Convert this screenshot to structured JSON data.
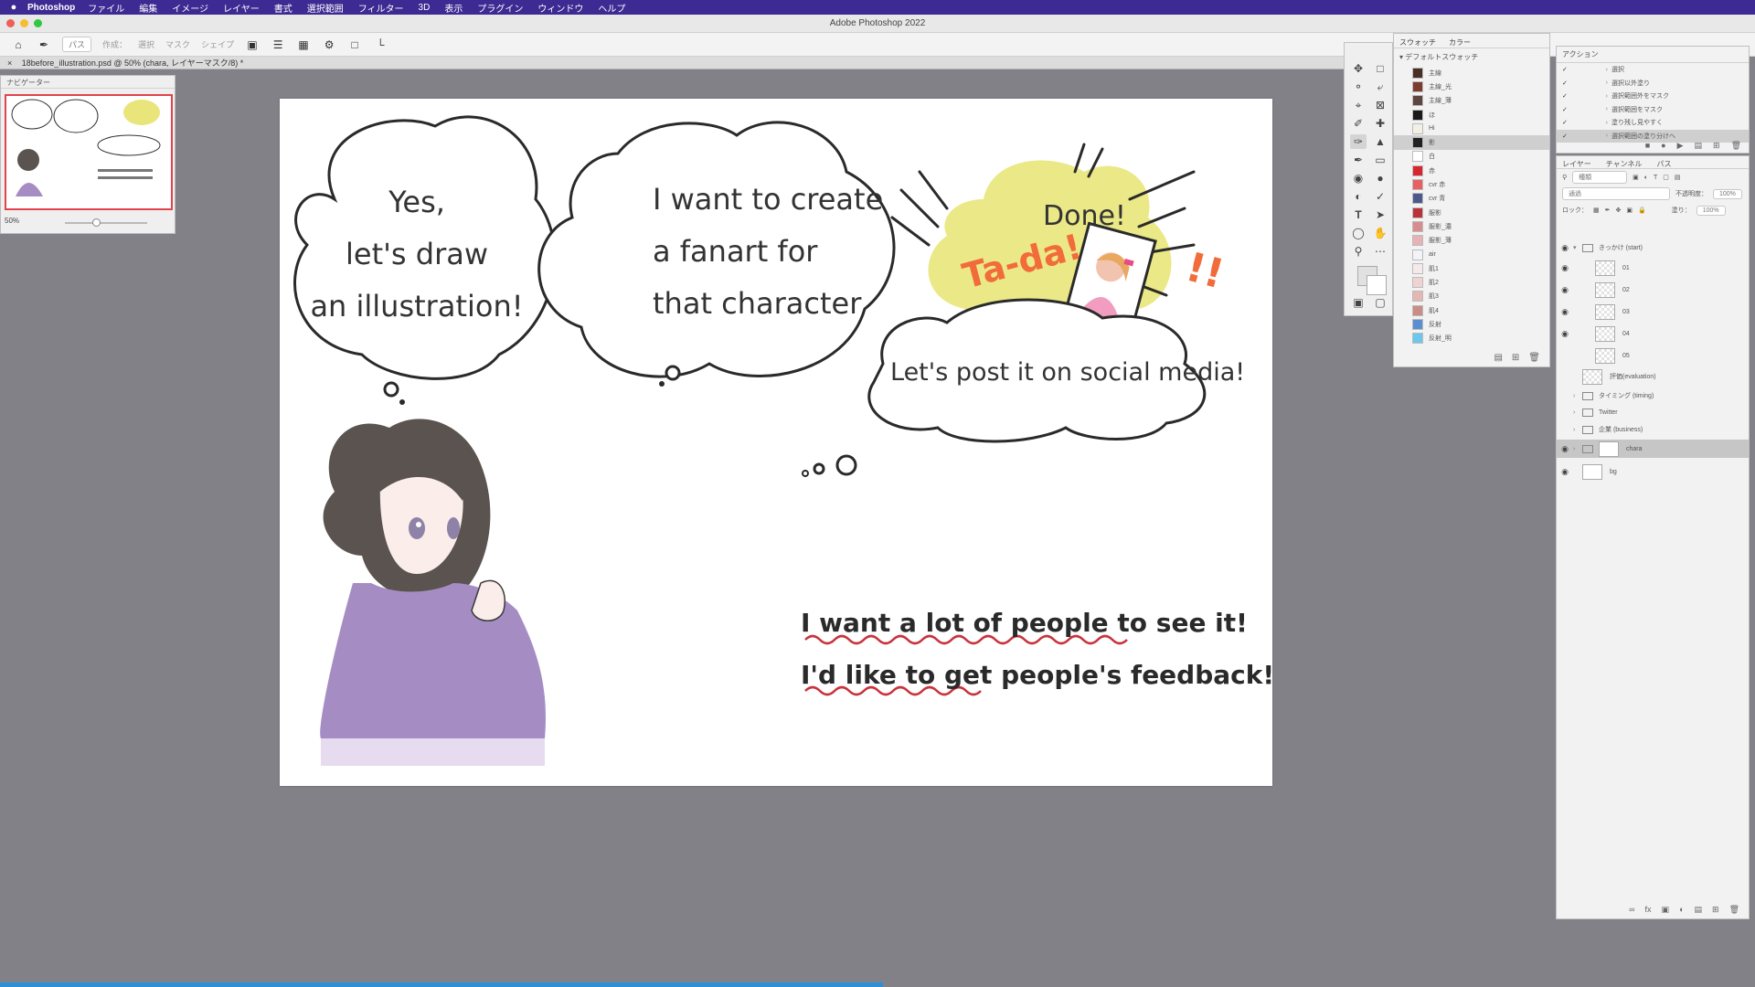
{
  "menubar": {
    "app": "Photoshop",
    "items": [
      "ファイル",
      "編集",
      "イメージ",
      "レイヤー",
      "書式",
      "選択範囲",
      "フィルター",
      "3D",
      "表示",
      "プラグイン",
      "ウィンドウ",
      "ヘルプ"
    ]
  },
  "window": {
    "title": "Adobe Photoshop 2022"
  },
  "options_bar": {
    "tool_mode": "パス",
    "make_label": "作成：",
    "select": "選択",
    "mask": "マスク",
    "shape": "シェイプ"
  },
  "document_tab": {
    "close": "×",
    "label": "18before_illustration.psd @ 50% (chara, レイヤーマスク/8) *"
  },
  "navigator": {
    "title": "ナビゲーター",
    "zoom": "50%"
  },
  "artwork": {
    "bubble1": [
      "Yes,",
      "let's draw",
      "an illustration!"
    ],
    "bubble2": [
      "I want to create",
      "a fanart for",
      "that character"
    ],
    "done": "Done!",
    "tada": "Ta-da!",
    "exclaim": "!!",
    "bubble3": "Let's post it on social media!",
    "line1": "I want a lot of people to see it!",
    "line2": "I'd like to get people's feedback!",
    "colors": {
      "tada": "#f26b3a",
      "burst": "#e9e57a",
      "underline": "#c8323b",
      "hoodie": "#a58dc4"
    }
  },
  "swatches": {
    "tabs": [
      "スウォッチ",
      "カラー"
    ],
    "group": "デフォルトスウォッチ",
    "items": [
      {
        "name": "主線",
        "color": "#4a2f26"
      },
      {
        "name": "主線_光",
        "color": "#7a3d2e"
      },
      {
        "name": "主線_薄",
        "color": "#5c4640"
      },
      {
        "name": "ほ",
        "color": "#1a1a1a"
      },
      {
        "name": "Hi",
        "color": "#f2f0e6"
      },
      {
        "name": "影",
        "color": "#222222"
      },
      {
        "name": "白",
        "color": "#ffffff"
      },
      {
        "name": "赤",
        "color": "#d7262f"
      },
      {
        "name": "cvr 赤",
        "color": "#e86060"
      },
      {
        "name": "cvr 青",
        "color": "#4a5a8a"
      },
      {
        "name": "服影",
        "color": "#b9323a"
      },
      {
        "name": "服影_濃",
        "color": "#d88c8f"
      },
      {
        "name": "服影_薄",
        "color": "#e7b2b4"
      },
      {
        "name": "air",
        "color": "#f2f2f8"
      },
      {
        "name": "肌1",
        "color": "#f5eaea"
      },
      {
        "name": "肌2",
        "color": "#efd3d0"
      },
      {
        "name": "肌3",
        "color": "#e5b7b2"
      },
      {
        "name": "肌4",
        "color": "#c98d86"
      },
      {
        "name": "反射",
        "color": "#5a8fd1"
      },
      {
        "name": "反射_明",
        "color": "#6cc7ec"
      }
    ]
  },
  "actions": {
    "title": "アクション",
    "items": [
      "選択",
      "選択以外塗り",
      "選択範囲外をマスク",
      "選択範囲をマスク",
      "塗り残し見やすく",
      "選択範囲の塗り分けへ"
    ]
  },
  "layers": {
    "tabs": [
      "レイヤー",
      "チャンネル",
      "パス"
    ],
    "filter": "種類",
    "blend": "通過",
    "opacity_label": "不透明度：",
    "opacity": "100%",
    "lock_label": "ロック：",
    "fill_label": "塗り：",
    "fill": "100%",
    "items": [
      {
        "name": "きっかけ (start)",
        "kind": "group",
        "visible": true
      },
      {
        "name": "01",
        "kind": "layer",
        "visible": true
      },
      {
        "name": "02",
        "kind": "layer",
        "visible": true
      },
      {
        "name": "03",
        "kind": "layer",
        "visible": true
      },
      {
        "name": "04",
        "kind": "layer",
        "visible": true
      },
      {
        "name": "05",
        "kind": "layer",
        "visible": false
      },
      {
        "name": "評価(evaluation)",
        "kind": "layer",
        "visible": false
      },
      {
        "name": "タイミング (timing)",
        "kind": "group",
        "visible": false
      },
      {
        "name": "Twitter",
        "kind": "group",
        "visible": false
      },
      {
        "name": "企業 (business)",
        "kind": "group",
        "visible": false
      },
      {
        "name": "chara",
        "kind": "group",
        "visible": true,
        "selected": true
      },
      {
        "name": "bg",
        "kind": "layer",
        "visible": true
      }
    ]
  },
  "progress": 0.503
}
